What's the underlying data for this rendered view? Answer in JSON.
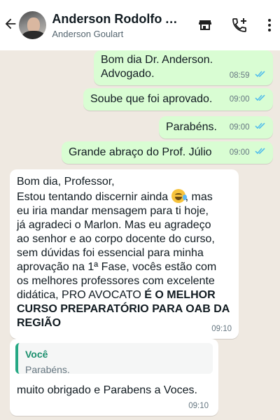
{
  "header": {
    "contact_name": "Anderson Rodolfo Al...",
    "subtitle": "Anderson Goulart",
    "icons": [
      "back-arrow-icon",
      "store-icon",
      "add-call-icon",
      "more-vert-icon"
    ]
  },
  "messages": [
    {
      "direction": "out",
      "text": "Bom dia Dr. Anderson.\nAdvogado.",
      "time": "08:59",
      "status": "read"
    },
    {
      "direction": "out",
      "text": "Soube que foi aprovado.",
      "time": "09:00",
      "status": "read"
    },
    {
      "direction": "out",
      "text": "Parabéns.",
      "time": "09:00",
      "status": "read"
    },
    {
      "direction": "out",
      "text": "Grande abraço do Prof. Júlio",
      "time": "09:00",
      "status": "read"
    },
    {
      "direction": "in",
      "greeting": "Bom dia, Professor,",
      "text_before_emoji": "Estou tentando discernir ainda",
      "emoji": "grinning-sweat-emoji",
      "text_after_emoji": ", mas",
      "body": "eu iria mandar mensagem para ti hoje,\njá agradeci o Marlon. Mas eu agradeço\nao senhor e ao corpo docente do curso,\nsem dúvidas foi essencial para minha\naprovação na 1ª Fase, vocês estão com\nos melhores professores com excelente\ndidática, PRO AVOCATO ",
      "bold_text": "É O MELHOR\nCURSO PREPARATÓRIO PARA OAB DA\nREGIÃO",
      "time": "09:10"
    },
    {
      "direction": "in",
      "quoted_author": "Você",
      "quoted_text": "Parabéns.",
      "text": "muito obrigado e Parabens a Voces.",
      "time": "09:10"
    }
  ],
  "colors": {
    "outgoing_bubble": "#d9fdd3",
    "incoming_bubble": "#ffffff",
    "read_ticks": "#53bdeb",
    "chat_background": "#efe9e1",
    "quote_accent": "#25a884"
  }
}
